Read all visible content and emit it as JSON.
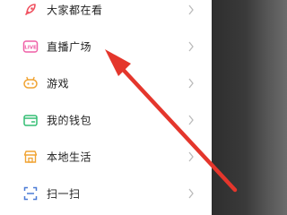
{
  "menu": {
    "items": [
      {
        "label": "大家都在看",
        "icon": "rocket-icon",
        "color": "#f0505f"
      },
      {
        "label": "直播广场",
        "icon": "live-icon",
        "color": "#ef5fa6"
      },
      {
        "label": "游戏",
        "icon": "gamepad-icon",
        "color": "#f0a332"
      },
      {
        "label": "我的钱包",
        "icon": "wallet-icon",
        "color": "#33bd73"
      },
      {
        "label": "本地生活",
        "icon": "shop-icon",
        "color": "#f0a332"
      },
      {
        "label": "扫一扫",
        "icon": "scan-icon",
        "color": "#4b7bd6"
      }
    ]
  },
  "live_icon_text": "LIVE",
  "colors": {
    "annotation_arrow": "#e4362c",
    "side_panel": "#3a3a3a",
    "chevron": "#bbbbbb"
  }
}
